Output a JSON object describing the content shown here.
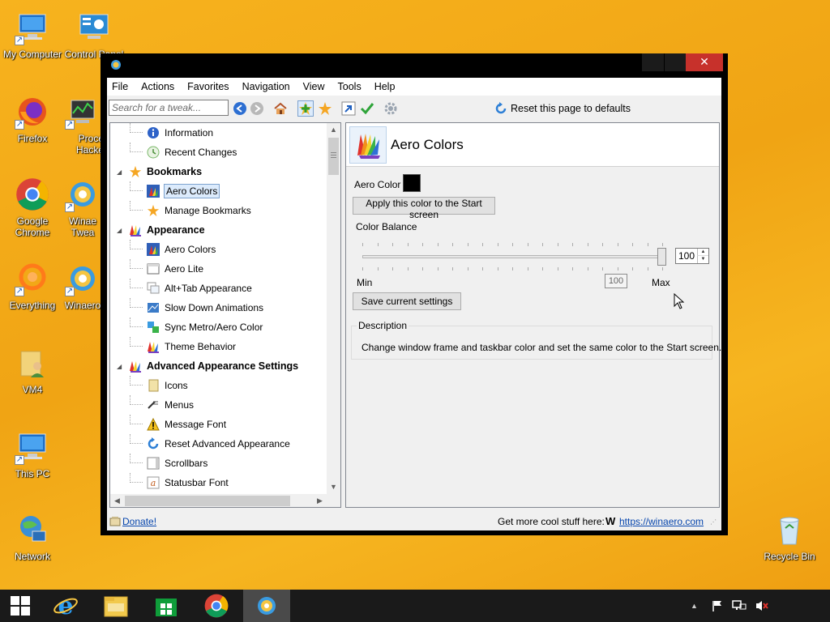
{
  "desktop": {
    "icons": [
      {
        "label": "My Computer"
      },
      {
        "label": "Control Panel"
      },
      {
        "label": "Firefox"
      },
      {
        "label": "Proce Hacke"
      },
      {
        "label": "Google Chrome"
      },
      {
        "label": "Winae Twea"
      },
      {
        "label": "Everything"
      },
      {
        "label": "Winaero"
      },
      {
        "label": "VM4"
      },
      {
        "label": "This PC"
      },
      {
        "label": "Network"
      },
      {
        "label": "Recycle Bin"
      }
    ]
  },
  "window": {
    "close_glyph": "✕",
    "menu": [
      "File",
      "Actions",
      "Favorites",
      "Navigation",
      "View",
      "Tools",
      "Help"
    ],
    "search_placeholder": "Search for a tweak...",
    "reset_label": "Reset this page to defaults",
    "tree": {
      "items": [
        {
          "label": "Information",
          "level": 1,
          "icon": "info-icon"
        },
        {
          "label": "Recent Changes",
          "level": 1,
          "icon": "recent-changes-icon"
        },
        {
          "label": "Bookmarks",
          "level": 0,
          "icon": "star-icon"
        },
        {
          "label": "Aero Colors",
          "level": 1,
          "icon": "aero-colors-icon",
          "selected": true
        },
        {
          "label": "Manage Bookmarks",
          "level": 1,
          "icon": "star-icon"
        },
        {
          "label": "Appearance",
          "level": 0,
          "icon": "appearance-icon"
        },
        {
          "label": "Aero Colors",
          "level": 1,
          "icon": "aero-colors-icon"
        },
        {
          "label": "Aero Lite",
          "level": 1,
          "icon": "window-icon"
        },
        {
          "label": "Alt+Tab Appearance",
          "level": 1,
          "icon": "alt-tab-icon"
        },
        {
          "label": "Slow Down Animations",
          "level": 1,
          "icon": "animation-icon"
        },
        {
          "label": "Sync Metro/Aero Color",
          "level": 1,
          "icon": "sync-icon"
        },
        {
          "label": "Theme Behavior",
          "level": 1,
          "icon": "theme-icon"
        },
        {
          "label": "Advanced Appearance Settings",
          "level": 0,
          "icon": "appearance-icon"
        },
        {
          "label": "Icons",
          "level": 1,
          "icon": "icons-icon"
        },
        {
          "label": "Menus",
          "level": 1,
          "icon": "menus-icon"
        },
        {
          "label": "Message Font",
          "level": 1,
          "icon": "warning-icon"
        },
        {
          "label": "Reset Advanced Appearance",
          "level": 1,
          "icon": "reset-icon"
        },
        {
          "label": "Scrollbars",
          "level": 1,
          "icon": "scrollbars-icon"
        },
        {
          "label": "Statusbar Font",
          "level": 1,
          "icon": "font-icon"
        }
      ]
    },
    "panel": {
      "title": "Aero Colors",
      "aero_color_label": "Aero Color",
      "aero_color_value": "#000000",
      "apply_button": "Apply this color to the Start screen",
      "balance_label": "Color Balance",
      "balance_value": "100",
      "min_label": "Min",
      "max_label": "Max",
      "save_button": "Save current settings",
      "description_label": "Description",
      "description_text": "Change window frame and taskbar color and set the same color to the Start screen.",
      "tooltip": "100"
    },
    "status": {
      "donate": "Donate!",
      "more": "Get more cool stuff here:",
      "w_glyph": "W",
      "url": "https://winaero.com"
    }
  },
  "colors": {
    "desktop": "#f3ab1a",
    "taskbar": "#1a1a1a",
    "close_button": "#c7312b",
    "link": "#0645ad"
  }
}
